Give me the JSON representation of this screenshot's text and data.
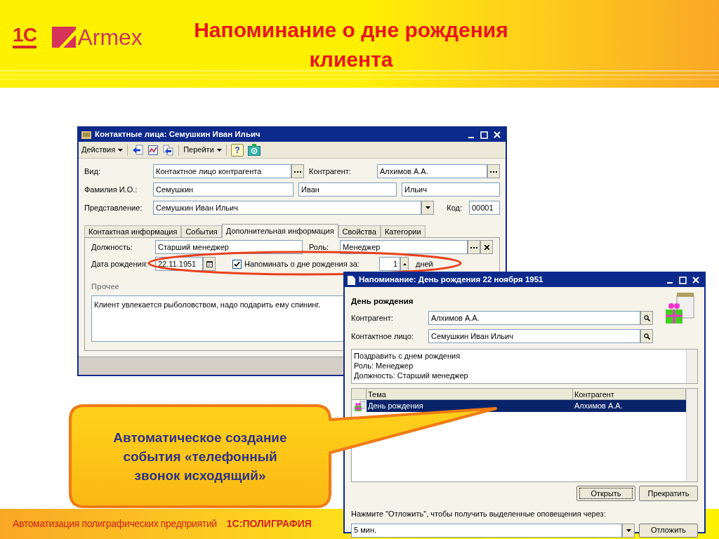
{
  "slide": {
    "logos": [
      "1С",
      "Armex"
    ],
    "title": "Напоминание о дне рождения клиента",
    "footer_text": "Автоматизация полиграфических предприятий",
    "footer_brand": "1С:ПОЛИГРАФИЯ"
  },
  "contact_window": {
    "title": "Контактные лица: Семушкин Иван Ильич",
    "toolbar": [
      {
        "kind": "menu",
        "label": "Действия"
      },
      {
        "kind": "icon"
      },
      {
        "kind": "icon"
      },
      {
        "kind": "icon"
      },
      {
        "kind": "menu",
        "label": "Перейти"
      },
      {
        "kind": "help",
        "label": "?"
      },
      {
        "kind": "icon"
      }
    ],
    "vid": {
      "label": "Вид:",
      "value": "Контактное лицо контрагента"
    },
    "kontragent": {
      "label": "Контрагент:",
      "value": "Алхимов А.А."
    },
    "fio": {
      "label": "Фамилия И.О.:",
      "last_name": "Семушкин",
      "first_name": "Иван",
      "middle_name": "Ильич"
    },
    "representation": {
      "label": "Представление:",
      "value": "Семушкин Иван Ильич"
    },
    "code": {
      "label": "Код:",
      "value": "00001"
    },
    "tabs": [
      {
        "label": "Контактная информация",
        "selected": false
      },
      {
        "label": "События",
        "selected": false
      },
      {
        "label": "Дополнительная информация",
        "selected": true
      },
      {
        "label": "Свойства",
        "selected": false
      },
      {
        "label": "Категории",
        "selected": false
      }
    ],
    "position": {
      "label": "Должность:",
      "value": "Старший менеджер"
    },
    "role": {
      "label": "Роль:",
      "value": "Менеджер"
    },
    "birth_date": {
      "label": "Дата рождения:",
      "value": "22.11.1951"
    },
    "remind": {
      "label": "Напоминать о дне рождения за:",
      "checked": true,
      "days": "1",
      "unit": "дней"
    },
    "other": {
      "label": "Прочее",
      "value": "Клиент увлекается рыболовством, надо подарить ему спининг."
    }
  },
  "reminder_window": {
    "title": "Напоминание: День рождения 22 ноября 1951",
    "heading": "День рождения",
    "fields": [
      {
        "label": "Контрагент:",
        "value": "Алхимов А.А."
      },
      {
        "label": "Контактное лицо:",
        "value": "Семушкин Иван Ильич"
      }
    ],
    "memo": [
      "Поздравить с днем рождения",
      "Роль: Менеджер",
      "Должность: Старший менеджер"
    ],
    "table": {
      "columns": [
        "Тема",
        "Контрагент"
      ],
      "rows": [
        {
          "cells": [
            "День рождения",
            "Алхимов А.А."
          ],
          "selected": true
        }
      ]
    },
    "buttons": [
      {
        "label": "Открыть",
        "focused": true
      },
      {
        "label": "Прекратить",
        "focused": false
      }
    ],
    "postpone_hint": "Нажмите \"Отложить\", чтобы получить выделенные оповещения через:",
    "postpone_interval": "5 мин.",
    "postpone_button": "Отложить"
  },
  "callout": {
    "text": "Автоматическое создание события «телефонный звонок исходящий»"
  }
}
